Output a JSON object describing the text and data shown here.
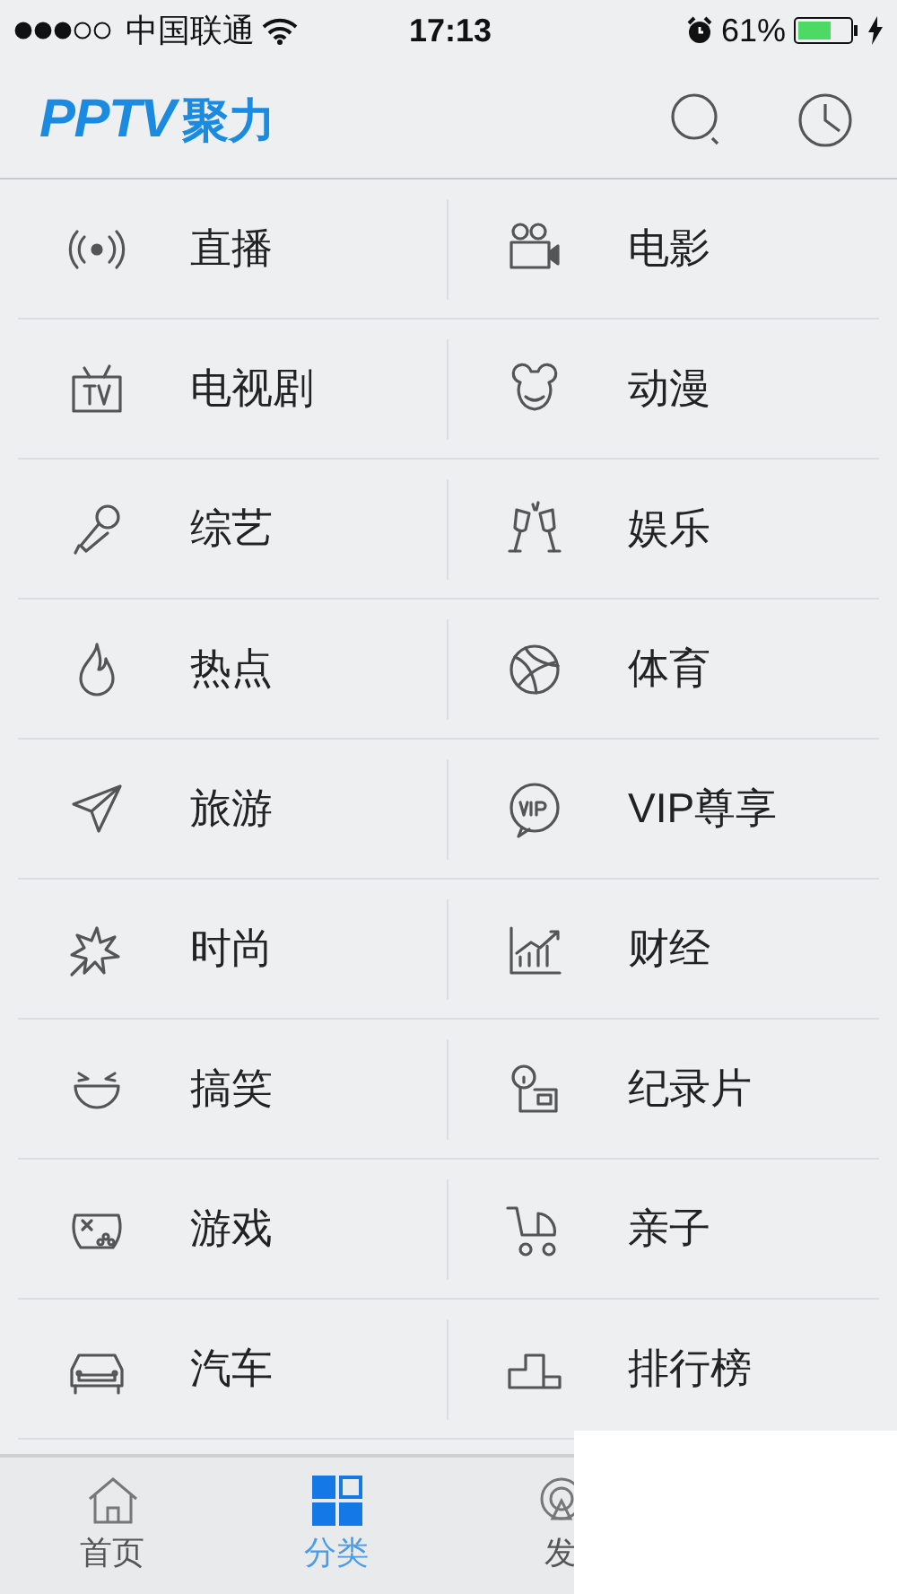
{
  "status_bar": {
    "carrier": "中国联通",
    "time": "17:13",
    "battery": "61%"
  },
  "header": {
    "logo": "PPTV",
    "logo_suffix": "聚力"
  },
  "categories": [
    {
      "label": "直播"
    },
    {
      "label": "电影"
    },
    {
      "label": "电视剧"
    },
    {
      "label": "动漫"
    },
    {
      "label": "综艺"
    },
    {
      "label": "娱乐"
    },
    {
      "label": "热点"
    },
    {
      "label": "体育"
    },
    {
      "label": "旅游"
    },
    {
      "label": "VIP尊享"
    },
    {
      "label": "时尚"
    },
    {
      "label": "财经"
    },
    {
      "label": "搞笑"
    },
    {
      "label": "纪录片"
    },
    {
      "label": "游戏"
    },
    {
      "label": "亲子"
    },
    {
      "label": "汽车"
    },
    {
      "label": "排行榜"
    }
  ],
  "tab_bar": [
    {
      "label": "首页",
      "selected": false
    },
    {
      "label": "分类",
      "selected": true
    },
    {
      "label": "发",
      "selected": false
    }
  ]
}
